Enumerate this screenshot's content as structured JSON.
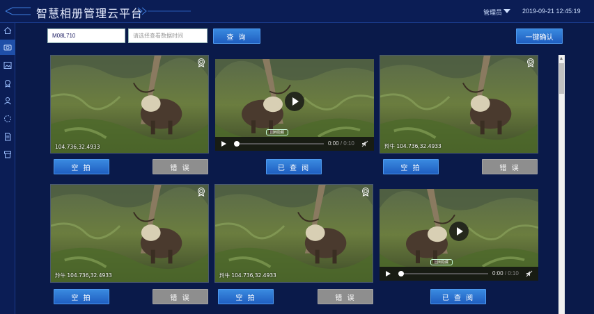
{
  "header": {
    "title": "智慧相册管理云平台",
    "user": "管理员",
    "datetime": "2019-09-21 12:45:19"
  },
  "sidebar": {
    "items": [
      {
        "icon": "home-icon",
        "active": false
      },
      {
        "icon": "camera-icon",
        "active": true
      },
      {
        "icon": "image-icon",
        "active": false
      },
      {
        "icon": "award-icon",
        "active": false
      },
      {
        "icon": "user-icon",
        "active": false
      },
      {
        "icon": "refresh-icon",
        "active": false
      },
      {
        "icon": "document-icon",
        "active": false
      },
      {
        "icon": "archive-icon",
        "active": false
      }
    ]
  },
  "toolbar": {
    "device_value": "M08L710",
    "time_placeholder": "请选择查看数据时间",
    "query_label": "查 询",
    "confirm_all_label": "一键确认"
  },
  "cards": [
    {
      "type": "photo",
      "caption": "104.736,32.4933",
      "actions": [
        "空 拍",
        "错 误"
      ]
    },
    {
      "type": "video",
      "time": "0:00",
      "duration": "/ 0:10",
      "stamp": "回到隐藏",
      "actions": [
        "已 查 阅"
      ]
    },
    {
      "type": "photo",
      "caption": "羚牛 104.736,32.4933",
      "actions": [
        "空 拍",
        "错 误"
      ]
    },
    {
      "type": "photo",
      "caption": "羚牛 104.736,32.4933",
      "actions": [
        "空 拍",
        "错 误"
      ]
    },
    {
      "type": "photo",
      "caption": "羚牛 104.736,32.4933",
      "actions": [
        "空 拍",
        "错 误"
      ]
    },
    {
      "type": "video",
      "time": "0:00",
      "duration": "/ 0:10",
      "stamp": "回到隐藏",
      "actions": [
        "已 查 阅"
      ]
    }
  ],
  "colors": {
    "background": "#0a1a4a",
    "header": "#0b1d55",
    "accent_blue": "#2a72d2",
    "gray_button": "#8e8e8e"
  }
}
